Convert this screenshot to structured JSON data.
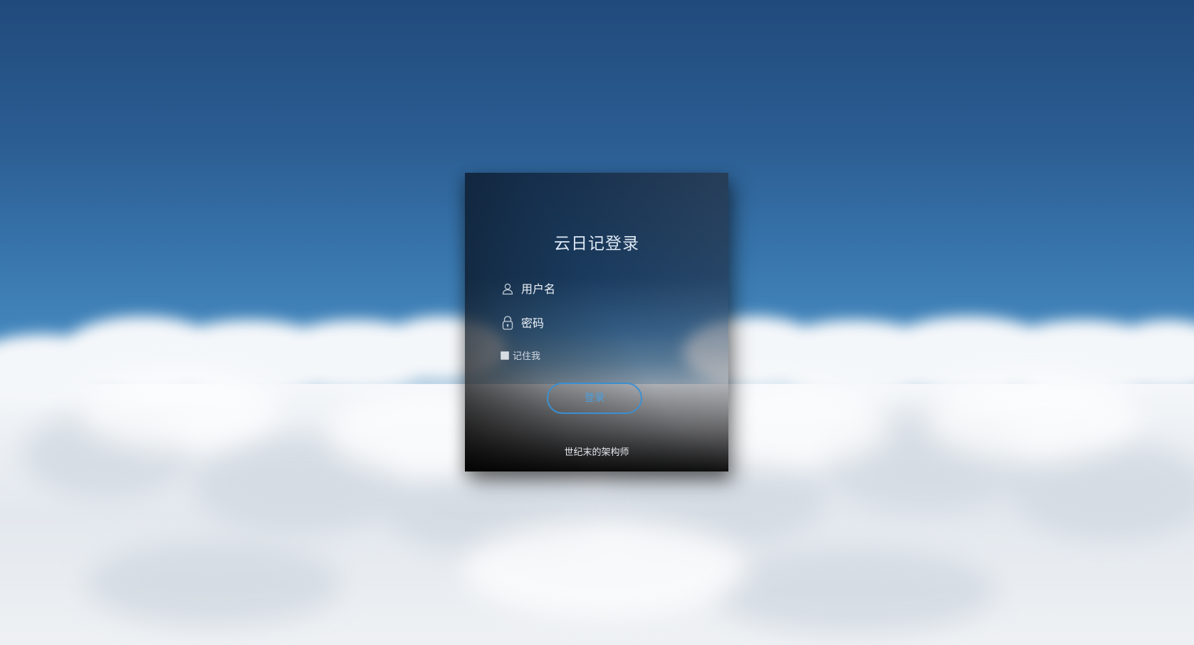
{
  "login": {
    "title": "云日记登录",
    "username_placeholder": "用户名",
    "password_placeholder": "密码",
    "remember_label": "记住我",
    "login_button": "登录",
    "footer": "世纪末的架构师"
  },
  "icons": {
    "user": "user-icon",
    "lock": "lock-icon"
  },
  "colors": {
    "accent": "#3b8fd1",
    "sky_top": "#214a7c",
    "sky_bottom": "#4487bd",
    "cloud": "#eef1f4"
  }
}
